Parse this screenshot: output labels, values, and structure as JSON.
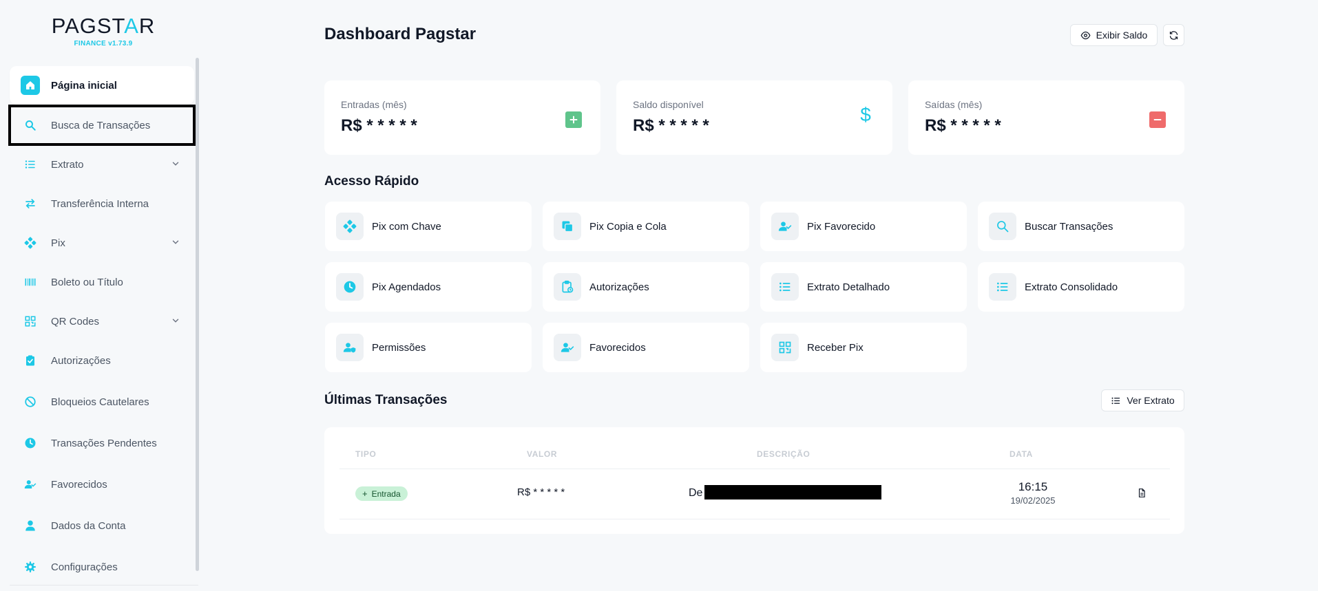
{
  "brand": {
    "name_pre": "PAGST",
    "name_star": "A",
    "name_post": "R",
    "subtitle": "FINANCE v1.73.9"
  },
  "sidebar": {
    "items": [
      {
        "label": "Página inicial",
        "icon": "home-icon"
      },
      {
        "label": "Busca de Transações",
        "icon": "search-icon"
      },
      {
        "label": "Extrato",
        "icon": "list-icon"
      },
      {
        "label": "Transferência Interna",
        "icon": "transfer-icon"
      },
      {
        "label": "Pix",
        "icon": "pix-icon"
      },
      {
        "label": "Boleto ou Título",
        "icon": "barcode-icon"
      },
      {
        "label": "QR Codes",
        "icon": "qr-icon"
      },
      {
        "label": "Autorizações",
        "icon": "clipboard-check-icon"
      },
      {
        "label": "Bloqueios Cautelares",
        "icon": "block-icon"
      },
      {
        "label": "Transações Pendentes",
        "icon": "clock-icon"
      },
      {
        "label": "Favorecidos",
        "icon": "user-check-icon"
      },
      {
        "label": "Dados da Conta",
        "icon": "user-icon"
      },
      {
        "label": "Configurações",
        "icon": "gear-icon"
      }
    ]
  },
  "header": {
    "title": "Dashboard Pagstar",
    "show_balance_label": "Exibir Saldo"
  },
  "stats": [
    {
      "label": "Entradas (mês)",
      "value": "R$ * * * * *",
      "color": "#5fc48b"
    },
    {
      "label": "Saldo disponível",
      "value": "R$ * * * * *",
      "color": "#1dc8e6"
    },
    {
      "label": "Saídas (mês)",
      "value": "R$ * * * * *",
      "color": "#ef6b6b"
    }
  ],
  "quick_access": {
    "title": "Acesso Rápido",
    "items": [
      {
        "label": "Pix com Chave",
        "icon": "pix-icon"
      },
      {
        "label": "Pix Copia e Cola",
        "icon": "copy-icon"
      },
      {
        "label": "Pix Favorecido",
        "icon": "user-check-icon"
      },
      {
        "label": "Buscar Transações",
        "icon": "search-icon"
      },
      {
        "label": "Pix Agendados",
        "icon": "clock-icon"
      },
      {
        "label": "Autorizações",
        "icon": "clipboard-clock-icon"
      },
      {
        "label": "Extrato Detalhado",
        "icon": "list-icon"
      },
      {
        "label": "Extrato Consolidado",
        "icon": "list-icon"
      },
      {
        "label": "Permissões",
        "icon": "user-shield-icon"
      },
      {
        "label": "Favorecidos",
        "icon": "user-check-icon"
      },
      {
        "label": "Receber Pix",
        "icon": "qr-icon"
      }
    ]
  },
  "transactions": {
    "title": "Últimas Transações",
    "view_statement_label": "Ver Extrato",
    "columns": [
      "TIPO",
      "VALOR",
      "DESCRIÇÃO",
      "DATA"
    ],
    "rows": [
      {
        "type": "Entrada",
        "value": "R$ * * * * *",
        "description": "De",
        "time": "16:15",
        "date": "19/02/2025"
      }
    ]
  },
  "colors": {
    "accent": "#1dc8e6",
    "background": "#f6f8fa",
    "income": "#5fc48b",
    "expense": "#ef6b6b"
  }
}
